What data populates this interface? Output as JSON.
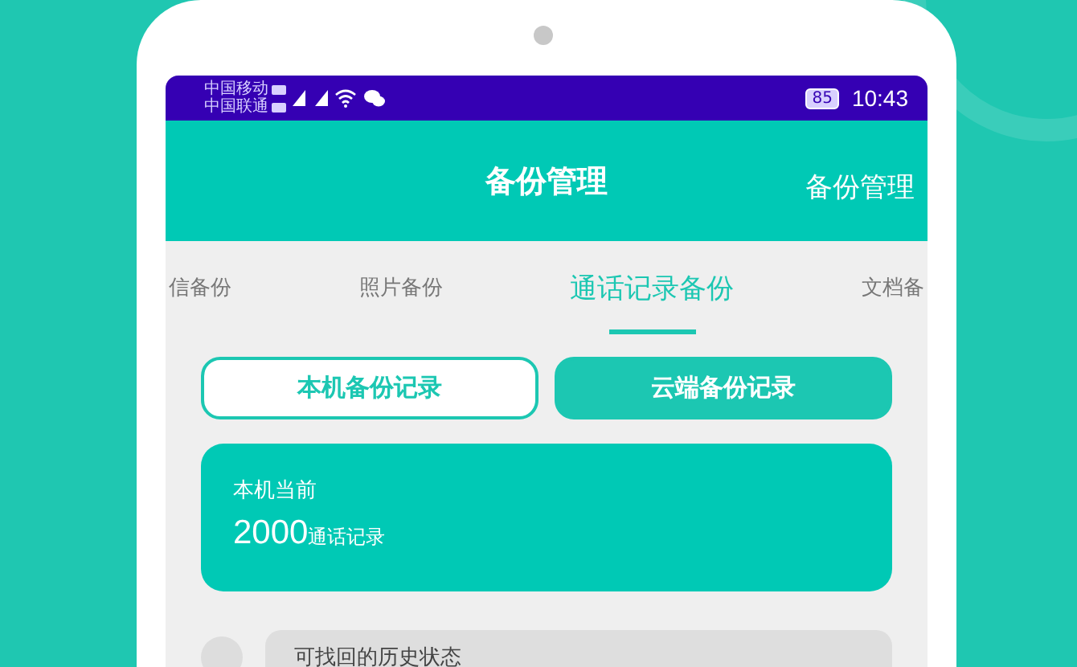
{
  "status_bar": {
    "carriers": [
      "中国移动",
      "中国联通"
    ],
    "battery": "85",
    "time": "10:43"
  },
  "header": {
    "title": "备份管理",
    "action": "备份管理"
  },
  "tabs": [
    {
      "label": "信备份",
      "selected": false
    },
    {
      "label": "照片备份",
      "selected": false
    },
    {
      "label": "通话记录备份",
      "selected": true
    },
    {
      "label": "文档备",
      "selected": false
    }
  ],
  "toggle": [
    {
      "label": "本机备份记录",
      "selected": true
    },
    {
      "label": "云端备份记录",
      "selected": false
    }
  ],
  "summary_card": {
    "label": "本机当前",
    "count": "2000",
    "unit": "通话记录"
  },
  "history": [
    {
      "label": "可找回的历史状态"
    }
  ]
}
